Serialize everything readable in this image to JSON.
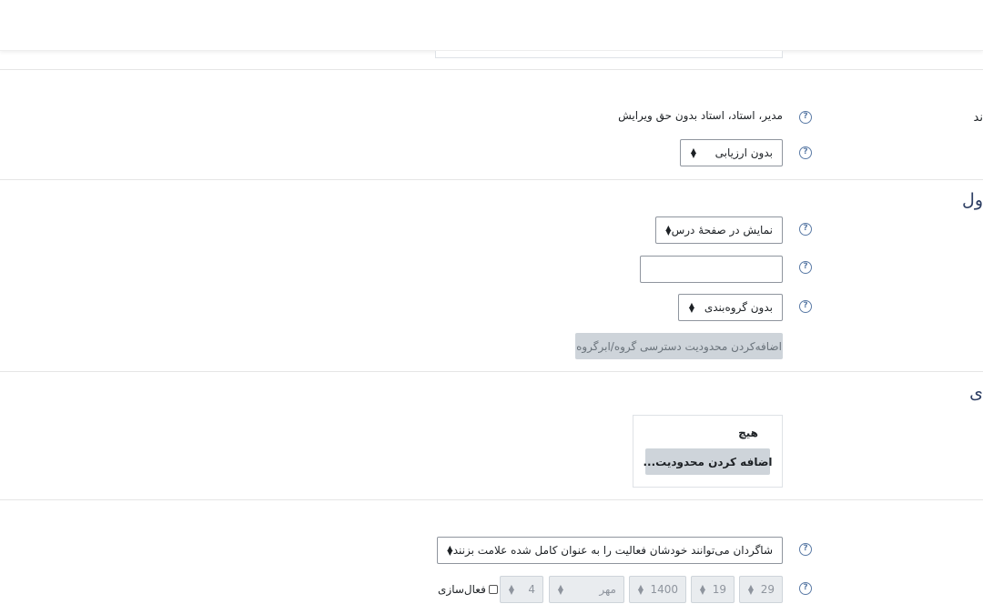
{
  "sections": {
    "grade_heading_partial": "ند",
    "common_module_heading_partial": "ول",
    "restrict_heading_partial": "ی"
  },
  "grade": {
    "roles_text": "مدیر، استاد، استاد بدون حق ویرایش",
    "grade_type_select": "بدون ارزیابی"
  },
  "common": {
    "availability_select": "نمایش در صفحهٔ درس",
    "id_number_value": "",
    "group_mode_select": "بدون گروه‌بندی",
    "add_group_restriction_button": "اضافه‌کردن محدودیت دسترسی گروه/ابرگروه"
  },
  "restrict": {
    "none_text": "هیچ",
    "add_restriction_button": "اضافه کردن محدودیت..."
  },
  "completion": {
    "tracking_select": "شاگردان می‌توانند خودشان فعالیت را به عنوان کامل شده علامت بزنند",
    "expected_date": {
      "day": "29",
      "hour": "19",
      "year": "1400",
      "month": "مهر",
      "minute": "4"
    },
    "enable_label": "فعال‌سازی"
  },
  "icons": {
    "help": "question-circle-icon",
    "select_arrows": "sort-arrows-icon"
  },
  "colors": {
    "heading": "#2d3e63",
    "help_icon": "#5b7ba6",
    "disabled_button_bg": "#ced4da"
  }
}
